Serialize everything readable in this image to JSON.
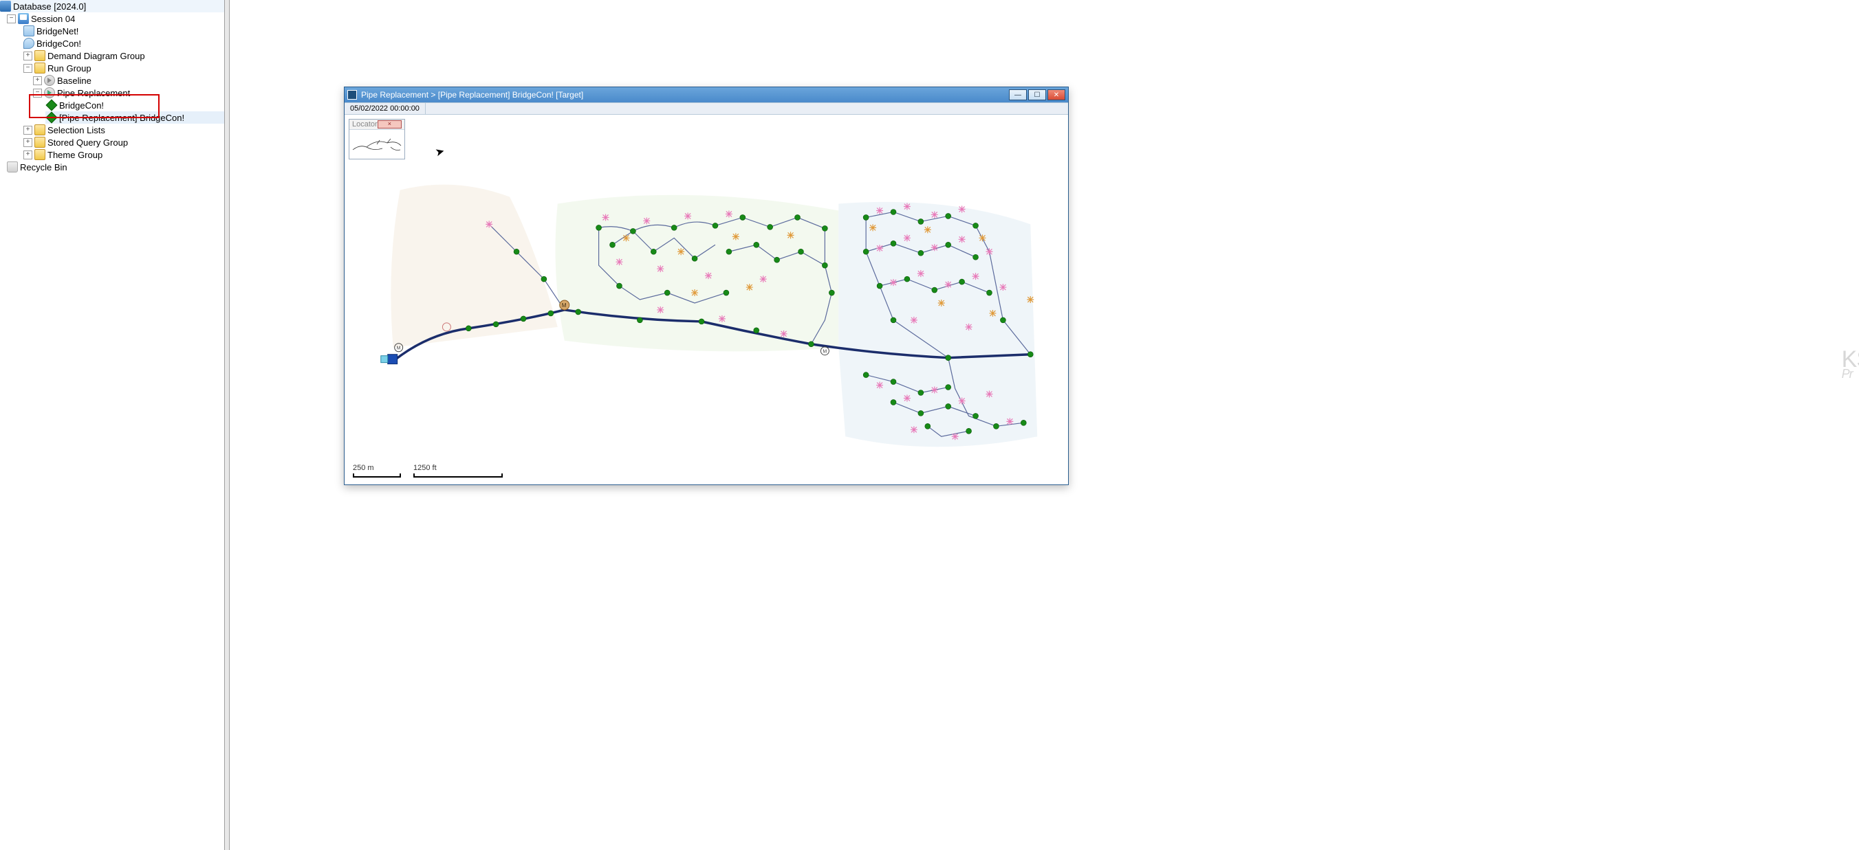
{
  "tree": {
    "root": {
      "label": "Database [2024.0]"
    },
    "session": {
      "label": "Session 04"
    },
    "bridgenet": {
      "label": "BridgeNet!"
    },
    "bridgecon": {
      "label": "BridgeCon!"
    },
    "ddg": {
      "label": "Demand Diagram Group"
    },
    "rungroup": {
      "label": "Run Group"
    },
    "baseline": {
      "label": "Baseline"
    },
    "pipe_repl": {
      "label": "Pipe Replacement"
    },
    "child_bc": {
      "label": "BridgeCon!"
    },
    "child_prbc": {
      "label": "[Pipe Replacement] BridgeCon!"
    },
    "sel_lists": {
      "label": "Selection Lists"
    },
    "sqg": {
      "label": "Stored Query Group"
    },
    "theme": {
      "label": "Theme Group"
    },
    "bin": {
      "label": "Recycle Bin"
    }
  },
  "viewer": {
    "title": "Pipe Replacement > [Pipe Replacement] BridgeCon!  [Target]",
    "datetime": "05/02/2022 00:00:00",
    "locator_label": "Locator",
    "scale_metric": "250 m",
    "scale_imperial": "1250 ft",
    "window_buttons": {
      "min": "—",
      "max": "☐",
      "close": "✕"
    }
  },
  "watermark": {
    "l1": "KS",
    "l2": "Pr"
  }
}
